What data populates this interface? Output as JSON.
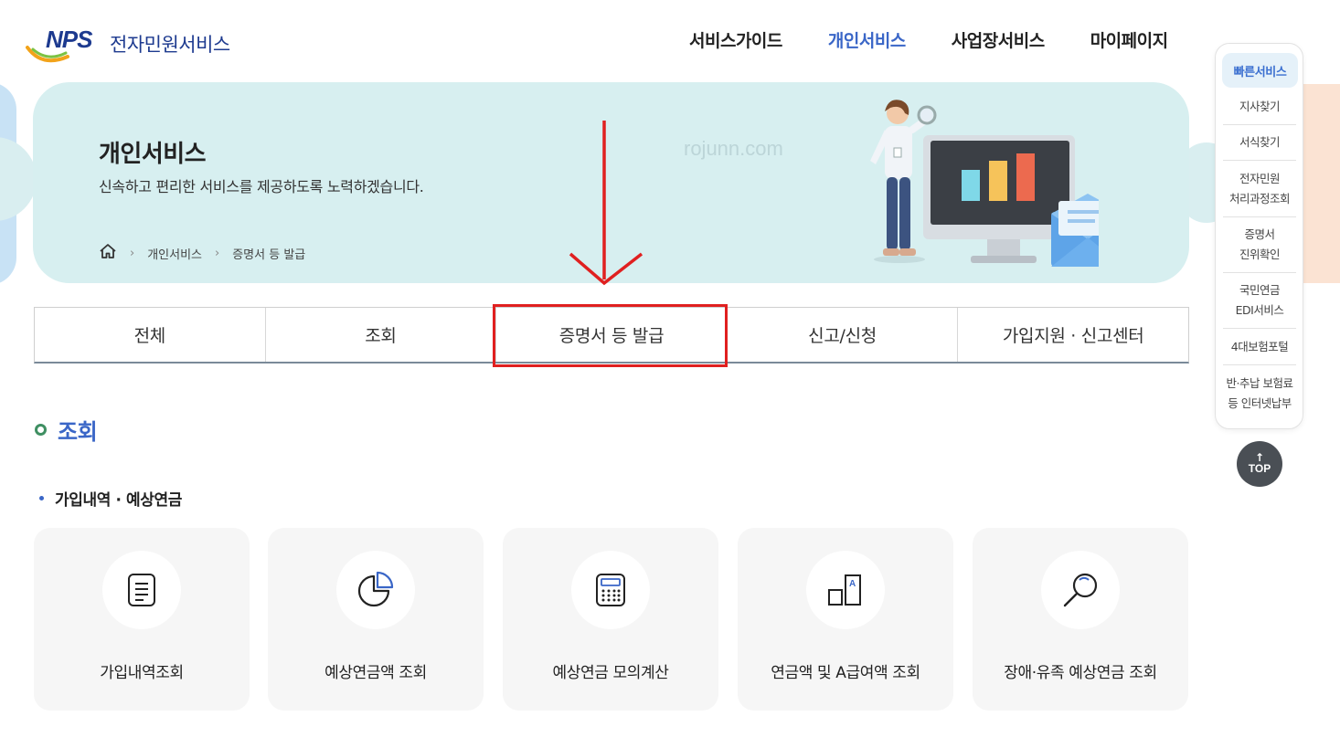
{
  "header": {
    "logo_mark": "NPS",
    "logo_name": "전자민원서비스",
    "nav": [
      {
        "label": "서비스가이드",
        "active": false
      },
      {
        "label": "개인서비스",
        "active": true
      },
      {
        "label": "사업장서비스",
        "active": false
      },
      {
        "label": "마이페이지",
        "active": false
      }
    ]
  },
  "hero": {
    "title": "개인서비스",
    "subtitle": "신속하고 편리한 서비스를 제공하도록 노력하겠습니다.",
    "watermark": "rojunn.com",
    "breadcrumb": [
      "개인서비스",
      "증명서 등 발급"
    ]
  },
  "tabs": [
    {
      "label": "전체"
    },
    {
      "label": "조회"
    },
    {
      "label": "증명서 등 발급",
      "highlighted": true
    },
    {
      "label": "신고/신청"
    },
    {
      "label": "가입지원 · 신고센터"
    }
  ],
  "section": {
    "title": "조회",
    "subtitle": "가입내역 · 예상연금"
  },
  "cards": [
    {
      "label": "가입내역조회",
      "icon": "document-icon"
    },
    {
      "label": "예상연금액 조회",
      "icon": "pie-chart-icon"
    },
    {
      "label": "예상연금 모의계산",
      "icon": "calculator-icon"
    },
    {
      "label": "연금액 및 A급여액 조회",
      "icon": "bar-a-icon"
    },
    {
      "label": "장애·유족 예상연금 조회",
      "icon": "search-icon"
    }
  ],
  "quick_menu": {
    "title": "빠른서비스",
    "items": [
      {
        "label": "지사찾기"
      },
      {
        "label": "서식찾기"
      },
      {
        "label": "전자민원\n처리과정조회"
      },
      {
        "label": "증명서\n진위확인"
      },
      {
        "label": "국민연금\nEDI서비스"
      },
      {
        "label": "4대보험포털"
      },
      {
        "label": "반·추납 보험료\n등 인터넷납부"
      }
    ],
    "top_arrow": "↑",
    "top_label": "TOP"
  },
  "colors": {
    "accent": "#3a66c7",
    "hero_bg": "#d7eff0",
    "highlight": "#e02020"
  }
}
